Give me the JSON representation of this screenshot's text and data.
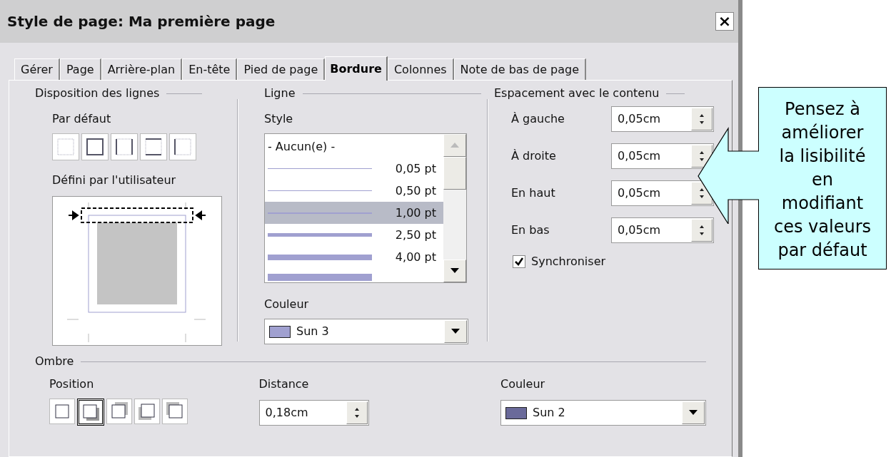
{
  "window": {
    "title": "Style de page: Ma première page",
    "close": "×"
  },
  "tabs": [
    {
      "label": "Gérer",
      "selected": false
    },
    {
      "label": "Page",
      "selected": false
    },
    {
      "label": "Arrière-plan",
      "selected": false
    },
    {
      "label": "En-tête",
      "selected": false
    },
    {
      "label": "Pied de page",
      "selected": false
    },
    {
      "label": "Bordure",
      "selected": true
    },
    {
      "label": "Colonnes",
      "selected": false
    },
    {
      "label": "Note de bas de page",
      "selected": false
    }
  ],
  "line_arrangement": {
    "title": "Disposition des lignes",
    "default_label": "Par défaut",
    "presets": [
      {
        "kind": "none",
        "selected": false
      },
      {
        "kind": "all",
        "selected": false
      },
      {
        "kind": "left_right",
        "selected": false
      },
      {
        "kind": "top_bottom",
        "selected": false
      },
      {
        "kind": "left",
        "selected": false
      }
    ],
    "user_defined_label": "Défini par l'utilisateur"
  },
  "line": {
    "title": "Ligne",
    "style_label": "Style",
    "styles": [
      {
        "kind": "none",
        "label": "- Aucun(e) -",
        "selected": false
      },
      {
        "kind": "hair",
        "label": "0,05 pt",
        "selected": false
      },
      {
        "kind": "hair",
        "label": "0,50 pt",
        "selected": false
      },
      {
        "kind": "thin",
        "label": "1,00 pt",
        "selected": true
      },
      {
        "kind": "medium",
        "label": "2,50 pt",
        "selected": false
      },
      {
        "kind": "thick",
        "label": "4,00 pt",
        "selected": false
      },
      {
        "kind": "heavy",
        "selected": false
      }
    ],
    "color_label": "Couleur",
    "color": {
      "label": "Sun 3",
      "color": "#a0a0d0"
    }
  },
  "spacing": {
    "title": "Espacement avec le contenu",
    "fields": [
      {
        "label": "À gauche",
        "value": "0,05cm"
      },
      {
        "label": "À droite",
        "value": "0,05cm"
      },
      {
        "label": "En haut",
        "value": "0,05cm"
      },
      {
        "label": "En bas",
        "value": "0,05cm"
      }
    ],
    "synchronize": {
      "label": "Synchroniser",
      "checked": true
    }
  },
  "shadow": {
    "title": "Ombre",
    "position_label": "Position",
    "positions": [
      {
        "kind": "none",
        "selected": false
      },
      {
        "kind": "bottom_right",
        "selected": true
      },
      {
        "kind": "top_right",
        "selected": false
      },
      {
        "kind": "bottom_left",
        "selected": false
      },
      {
        "kind": "top_left",
        "selected": false
      }
    ],
    "distance_label": "Distance",
    "distance": "0,18cm",
    "color_label": "Couleur",
    "color": {
      "label": "Sun 2",
      "color": "#6a6a9a"
    }
  },
  "callout": {
    "text": "Pensez à\naméliorer\nla lisibilité\nen\nmodifiant\nces valeurs\npar défaut"
  }
}
